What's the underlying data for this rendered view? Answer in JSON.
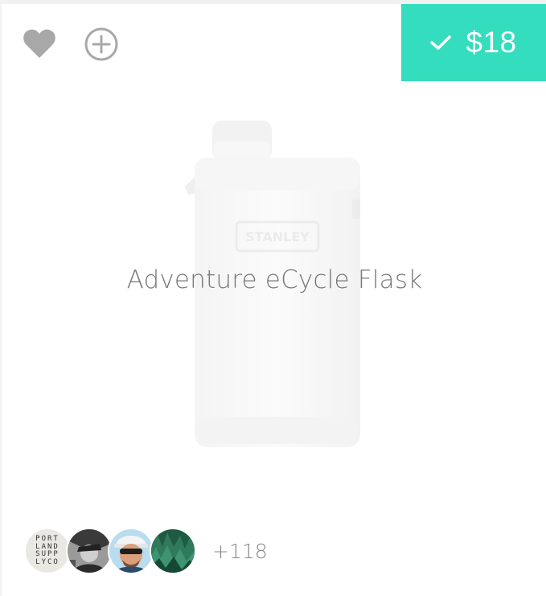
{
  "theme": {
    "accent": "#33ddbd",
    "icon_gray": "#a8a8a8",
    "title_gray": "#777777"
  },
  "actions": {
    "like_icon": "heart-icon",
    "add_icon": "plus-circle-icon"
  },
  "price_button": {
    "icon": "check-icon",
    "price": "$18"
  },
  "product": {
    "name": "Adventure eCycle Flask",
    "image_brand_text": "STANLEY"
  },
  "savers": {
    "avatars": [
      {
        "name": "portland-supply-co",
        "logo_lines": [
          "PORT",
          "LAND",
          "SUPP",
          "LYCO"
        ]
      },
      {
        "name": "user-bw-photo"
      },
      {
        "name": "user-cap-sunglasses"
      },
      {
        "name": "user-forest"
      }
    ],
    "more_count": "+118"
  }
}
